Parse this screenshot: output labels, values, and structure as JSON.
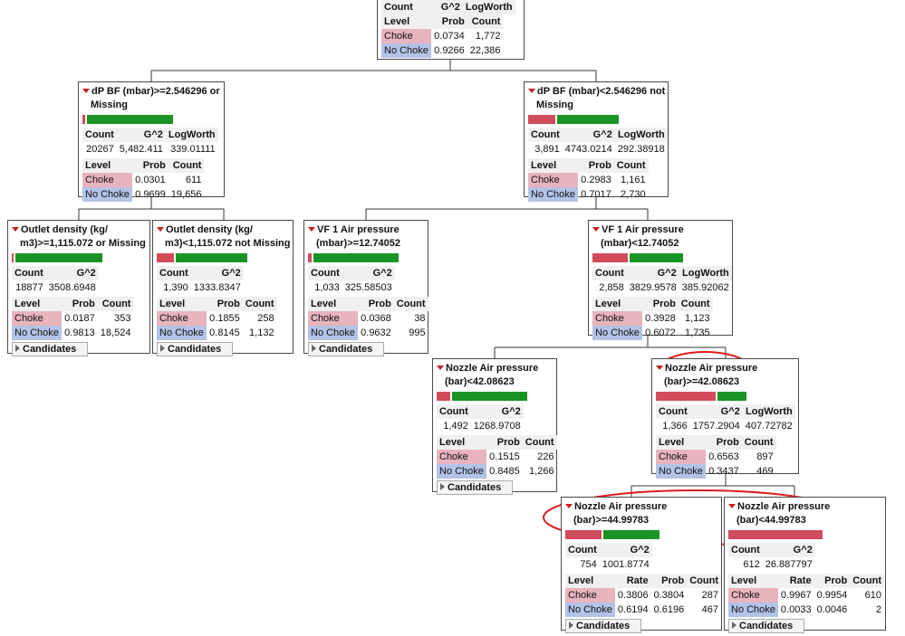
{
  "headers": {
    "count": "Count",
    "g2": "G^2",
    "logworth": "LogWorth",
    "level": "Level",
    "prob": "Prob",
    "rate": "Rate",
    "candidates": "Candidates"
  },
  "levels": {
    "choke": "Choke",
    "nochoke": "No Choke"
  },
  "colors": {
    "choke_bar": "#d24b5a",
    "nochoke_bar": "#1a9424",
    "annotation": "#e01a1a"
  },
  "root": {
    "count": "",
    "g2": "",
    "logworth": "",
    "choke": {
      "prob": "0.0734",
      "count": "1,772"
    },
    "nochoke": {
      "prob": "0.9266",
      "count": "22,386"
    }
  },
  "n1": {
    "title1": "dP BF (mbar)>=2.546296 or",
    "title2": "Missing",
    "choke_share": 0.0301,
    "count": "20267",
    "g2": "5,482.411",
    "logworth": "339.01111",
    "choke": {
      "prob": "0.0301",
      "count": "611"
    },
    "nochoke": {
      "prob": "0.9699",
      "count": "19,656"
    }
  },
  "n2": {
    "title1": "dP BF (mbar)<2.546296 not",
    "title2": "Missing",
    "choke_share": 0.2983,
    "count": "3,891",
    "g2": "4743.0214",
    "logworth": "292.38918",
    "choke": {
      "prob": "0.2983",
      "count": "1,161"
    },
    "nochoke": {
      "prob": "0.7017",
      "count": "2,730"
    }
  },
  "n3": {
    "title1": "Outlet density (kg/",
    "title2": "m3)>=1,115.072 or Missing",
    "choke_share": 0.0187,
    "count": "18877",
    "g2": "3508.6948",
    "choke": {
      "prob": "0.0187",
      "count": "353"
    },
    "nochoke": {
      "prob": "0.9813",
      "count": "18,524"
    }
  },
  "n4": {
    "title1": "Outlet density (kg/",
    "title2": "m3)<1,115.072 not Missing",
    "choke_share": 0.1855,
    "count": "1,390",
    "g2": "1333.8347",
    "choke": {
      "prob": "0.1855",
      "count": "258"
    },
    "nochoke": {
      "prob": "0.8145",
      "count": "1,132"
    }
  },
  "n5": {
    "title1": "VF 1 Air pressure",
    "title2": "(mbar)>=12.74052",
    "choke_share": 0.0368,
    "count": "1,033",
    "g2": "325.58503",
    "choke": {
      "prob": "0.0368",
      "count": "38"
    },
    "nochoke": {
      "prob": "0.9632",
      "count": "995"
    }
  },
  "n6": {
    "title1": "VF 1 Air pressure",
    "title2": "(mbar)<12.74052",
    "choke_share": 0.3928,
    "count": "2,858",
    "g2": "3829.9578",
    "logworth": "385.92062",
    "choke": {
      "prob": "0.3928",
      "count": "1,123"
    },
    "nochoke": {
      "prob": "0.6072",
      "count": "1,735"
    }
  },
  "n7": {
    "title1": "Nozzle Air pressure",
    "title2": "(bar)<42.08623",
    "choke_share": 0.1515,
    "count": "1,492",
    "g2": "1268.9708",
    "choke": {
      "prob": "0.1515",
      "count": "226"
    },
    "nochoke": {
      "prob": "0.8485",
      "count": "1,266"
    }
  },
  "n8": {
    "title1": "Nozzle Air pressure",
    "title2": "(bar)>=42.08623",
    "choke_share": 0.6563,
    "count": "1,366",
    "g2": "1757.2904",
    "logworth": "407.72782",
    "choke": {
      "prob": "0.6563",
      "count": "897"
    },
    "nochoke": {
      "prob": "0.3437",
      "count": "469"
    }
  },
  "n9": {
    "title1": "Nozzle Air pressure",
    "title2": "(bar)>=44.99783",
    "choke_share": 0.3804,
    "count": "754",
    "g2": "1001.8774",
    "choke": {
      "rate": "0.3806",
      "prob": "0.3804",
      "count": "287"
    },
    "nochoke": {
      "rate": "0.6194",
      "prob": "0.6196",
      "count": "467"
    }
  },
  "n10": {
    "title1": "Nozzle Air pressure",
    "title2": "(bar)<44.99783",
    "choke_share": 0.9954,
    "count": "612",
    "g2": "26.887797",
    "choke": {
      "rate": "0.9967",
      "prob": "0.9954",
      "count": "610"
    },
    "nochoke": {
      "rate": "0.0033",
      "prob": "0.0046",
      "count": "2"
    }
  }
}
